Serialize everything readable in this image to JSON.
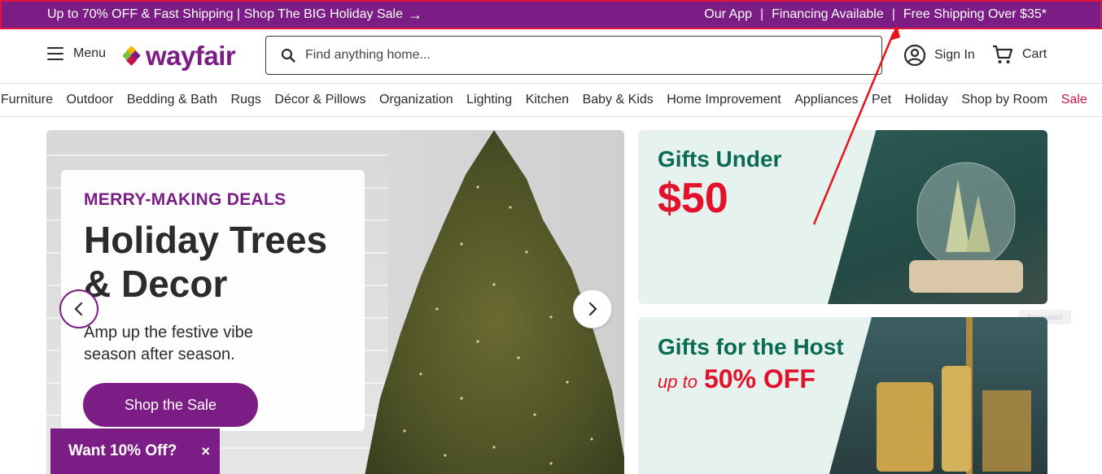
{
  "promo_bar": {
    "left_text": "Up to 70% OFF & Fast Shipping | Shop The BIG Holiday Sale",
    "arrow": "→",
    "our_app": "Our App",
    "financing": "Financing Available",
    "free_shipping": "Free Shipping Over $35*",
    "separator": "|",
    "background": "#7b1d85",
    "highlight_border": "#e0133d"
  },
  "header": {
    "menu_label": "Menu",
    "logo_text": "wayfair",
    "search_placeholder": "Find anything home...",
    "signin_label": "Sign In",
    "cart_label": "Cart"
  },
  "nav": {
    "items": [
      "Furniture",
      "Outdoor",
      "Bedding & Bath",
      "Rugs",
      "Décor & Pillows",
      "Organization",
      "Lighting",
      "Kitchen",
      "Baby & Kids",
      "Home Improvement",
      "Appliances",
      "Pet",
      "Holiday",
      "Shop by Room",
      "Sale"
    ],
    "sale_color": "#c4134a"
  },
  "hero": {
    "eyebrow": "MERRY-MAKING DEALS",
    "title_line1": "Holiday Trees",
    "title_line2": "& Decor",
    "subtitle": "Amp up the festive vibe season after season.",
    "button": "Shop the Sale"
  },
  "popup": {
    "label": "Want 10% Off?",
    "close": "×"
  },
  "promo_cards": {
    "card1_title": "Gifts Under",
    "card1_big": "$50",
    "card2_title": "Gifts for the Host",
    "card2_upto": "up to",
    "card2_pct": "50% OFF",
    "sponsored": "Sponsored"
  },
  "colors": {
    "brand_purple": "#7b1d85",
    "green_title": "#0b6b52",
    "red_offer": "#e3112b",
    "annotation_red": "#e8141c"
  }
}
